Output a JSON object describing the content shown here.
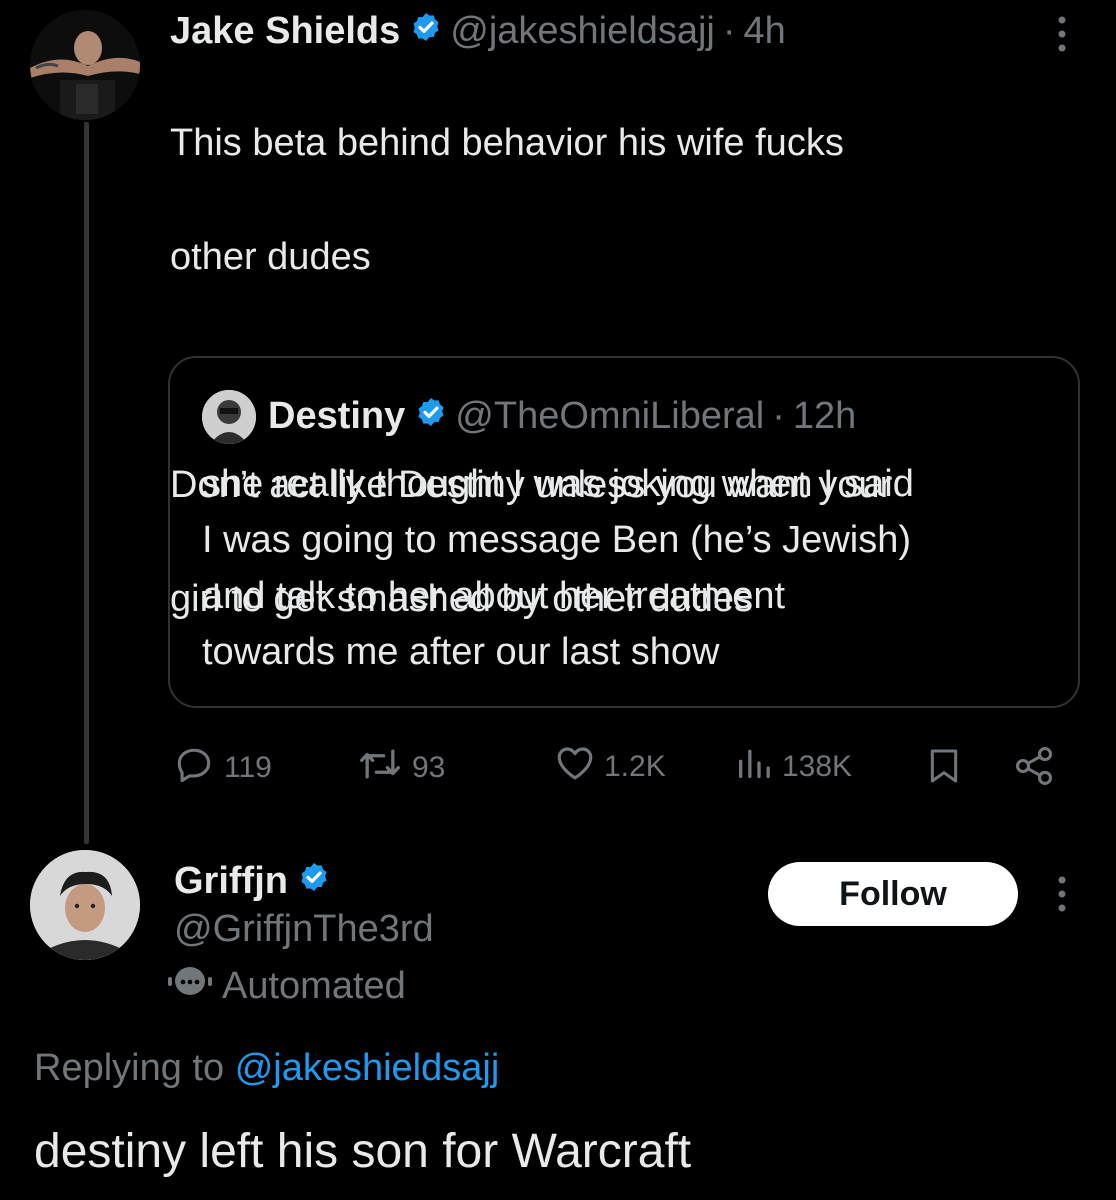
{
  "main_tweet": {
    "author_name": "Jake Shields",
    "handle": "@jakeshieldsajj",
    "separator": "·",
    "time": "4h",
    "text_line1": "This beta behind behavior his wife fucks",
    "text_line2": "other dudes",
    "text_para2_line1": "Don’t act like Destiny unless you want your",
    "text_para2_line2": "girl to get smashed by other dudes",
    "quote": {
      "author_name": "Destiny",
      "handle": "@TheOmniLiberal",
      "separator": "·",
      "time": "12h",
      "lines": [
        "she really thought I was joking when I said",
        "I was going to message Ben (he’s Jewish)",
        "and talk to her about her treatment",
        "towards me after our last show"
      ]
    },
    "stats": {
      "replies": "119",
      "reposts": "93",
      "likes": "1.2K",
      "views": "138K"
    }
  },
  "reply": {
    "author_name": "Griffjn",
    "handle": "@GriffjnThe3rd",
    "automated_label": "Automated",
    "follow_label": "Follow",
    "replying_to_prefix": "Replying to",
    "replying_to_handle": "@jakeshieldsajj",
    "text": "destiny left his son for Warcraft"
  },
  "colors": {
    "background": "#000000",
    "text": "#e7e9ea",
    "muted": "#71767b",
    "accent": "#1d9bf0",
    "border": "#2f3336"
  },
  "icons": [
    "verified-badge-icon",
    "more-icon",
    "reply-icon",
    "repost-icon",
    "like-icon",
    "views-icon",
    "bookmark-icon",
    "share-icon",
    "robot-icon"
  ]
}
